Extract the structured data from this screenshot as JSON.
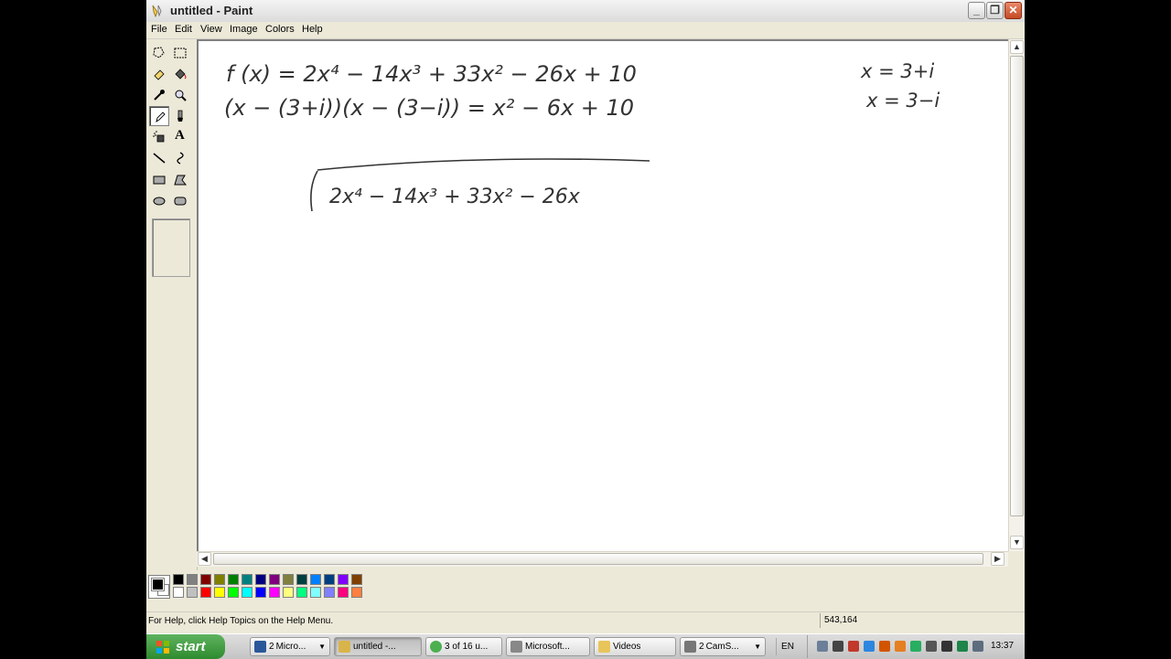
{
  "window": {
    "title": "untitled - Paint",
    "minimize": "_",
    "maximize": "❐",
    "close": "✕"
  },
  "menu": [
    "File",
    "Edit",
    "View",
    "Image",
    "Colors",
    "Help"
  ],
  "tools": [
    {
      "name": "free-form-select",
      "icon": "free-select-icon"
    },
    {
      "name": "select",
      "icon": "select-rect-icon"
    },
    {
      "name": "eraser",
      "icon": "eraser-icon"
    },
    {
      "name": "fill-with-color",
      "icon": "bucket-icon"
    },
    {
      "name": "pick-color",
      "icon": "eyedropper-icon"
    },
    {
      "name": "magnifier",
      "icon": "magnifier-icon"
    },
    {
      "name": "pencil",
      "icon": "pencil-icon",
      "selected": true
    },
    {
      "name": "brush",
      "icon": "brush-icon"
    },
    {
      "name": "airbrush",
      "icon": "airbrush-icon"
    },
    {
      "name": "text",
      "icon": "text-icon",
      "glyph": "A"
    },
    {
      "name": "line",
      "icon": "line-icon"
    },
    {
      "name": "curve",
      "icon": "curve-icon"
    },
    {
      "name": "rectangle",
      "icon": "rectangle-icon"
    },
    {
      "name": "polygon",
      "icon": "polygon-icon"
    },
    {
      "name": "ellipse",
      "icon": "ellipse-icon"
    },
    {
      "name": "rounded-rectangle",
      "icon": "rounded-rect-icon"
    }
  ],
  "canvas": {
    "handwriting": {
      "line1": "f (x) = 2x⁴ − 14x³ + 33x² − 26x + 10",
      "line2": "(x − (3+i))(x − (3−i)) = x² − 6x + 10",
      "root1": "x = 3+i",
      "root2": "x = 3−i",
      "division": "2x⁴ − 14x³ + 33x² − 26x"
    }
  },
  "palette": {
    "foreground": "#000000",
    "background": "#ffffff",
    "top_row": [
      "#000000",
      "#808080",
      "#800000",
      "#808000",
      "#008000",
      "#008080",
      "#000080",
      "#800080",
      "#808040",
      "#004040",
      "#0080ff",
      "#004080",
      "#8000ff",
      "#804000"
    ],
    "bottom_row": [
      "#ffffff",
      "#c0c0c0",
      "#ff0000",
      "#ffff00",
      "#00ff00",
      "#00ffff",
      "#0000ff",
      "#ff00ff",
      "#ffff80",
      "#00ff80",
      "#80ffff",
      "#8080ff",
      "#ff0080",
      "#ff8040"
    ]
  },
  "status": {
    "help": "For Help, click Help Topics on the Help Menu.",
    "coords": "543,164"
  },
  "taskbar": {
    "start": "start",
    "tasks": [
      {
        "count": "2",
        "label": "Micro...",
        "icon": "word-icon",
        "dropdown": true,
        "active": false
      },
      {
        "count": "",
        "label": "untitled -...",
        "icon": "paint-icon",
        "dropdown": false,
        "active": true
      },
      {
        "count": "",
        "label": "3 of 16 u...",
        "icon": "chrome-icon",
        "dropdown": false,
        "active": false
      },
      {
        "count": "",
        "label": "Microsoft...",
        "icon": "excel-icon",
        "dropdown": false,
        "active": false
      },
      {
        "count": "",
        "label": "Videos",
        "icon": "folder-icon",
        "dropdown": false,
        "active": false
      },
      {
        "count": "2",
        "label": "CamS...",
        "icon": "camstudio-icon",
        "dropdown": true,
        "active": false
      }
    ],
    "language": "EN",
    "clock": "13:37",
    "tray_icons": [
      "network-icon",
      "volume-icon",
      "security-icon",
      "messenger-icon",
      "update-icon",
      "antivirus-icon",
      "safely-remove-icon",
      "clock-sync-icon",
      "search-icon",
      "checkmark-icon",
      "tools-icon"
    ]
  }
}
